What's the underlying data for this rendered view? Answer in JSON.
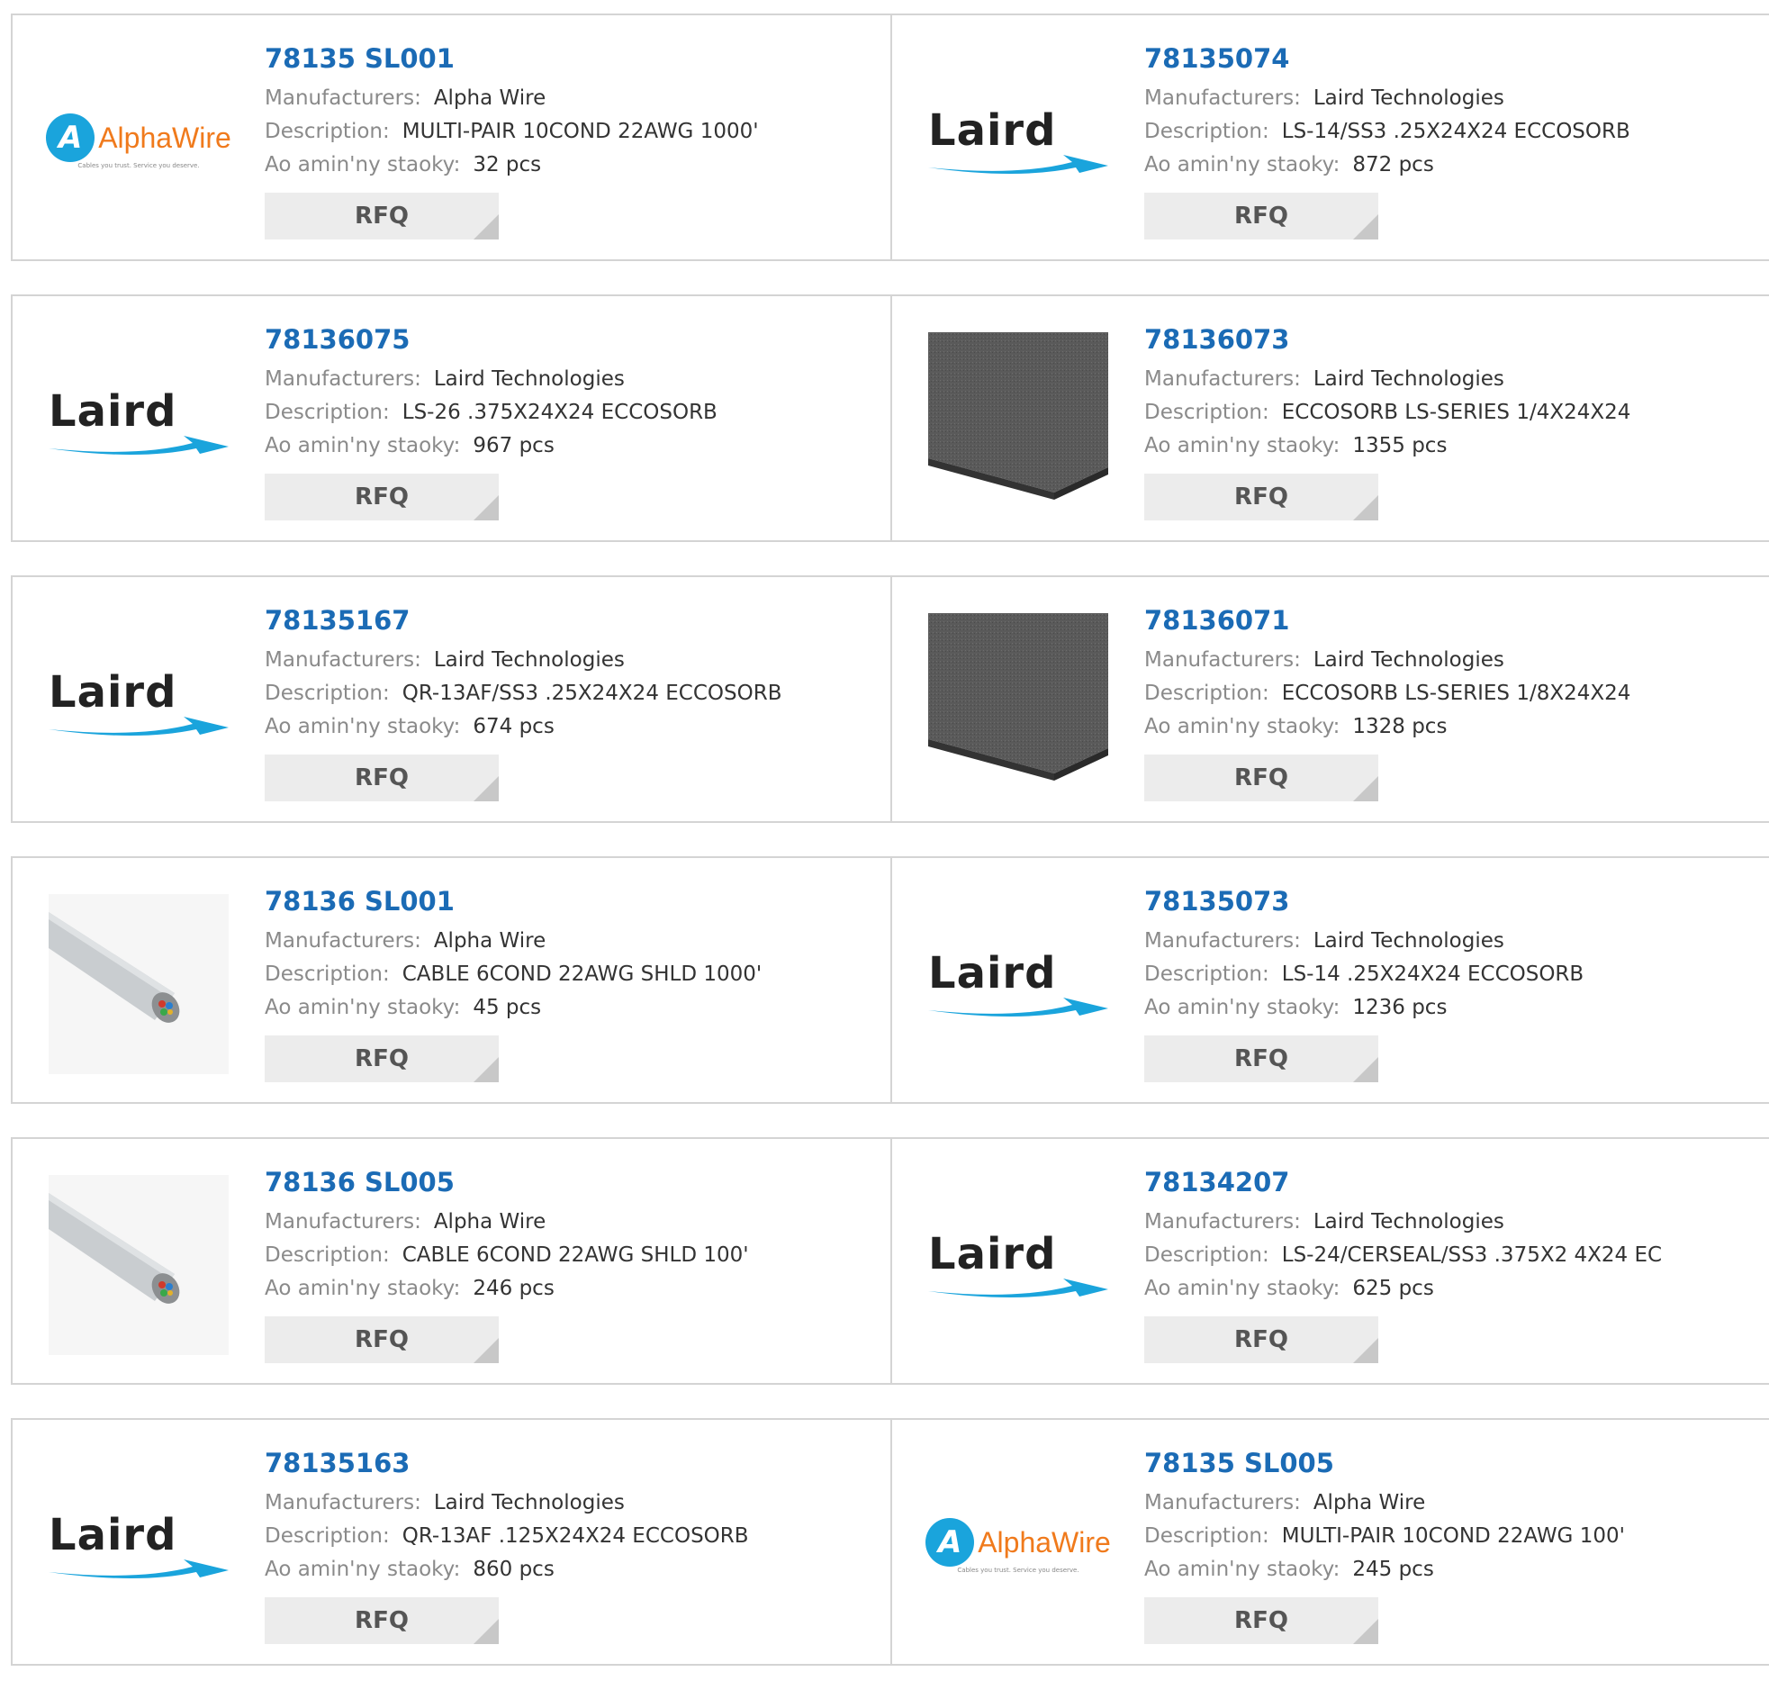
{
  "labels": {
    "manufacturers": "Manufacturers:",
    "description": "Description:",
    "stock": "Ao amin'ny staoky:",
    "rfq": "RFQ"
  },
  "brand_text": {
    "laird": "Laird",
    "alphawire_text": "AlphaWire",
    "alphawire_tagline": "Cables you trust. Service you deserve."
  },
  "products": [
    {
      "part": "78135 SL001",
      "manufacturer": "Alpha Wire",
      "description": "MULTI-PAIR 10COND 22AWG 1000'",
      "stock": "32 pcs",
      "image": "alphawire-logo"
    },
    {
      "part": "78135074",
      "manufacturer": "Laird Technologies",
      "description": "LS-14/SS3 .25X24X24 ECCOSORB",
      "stock": "872 pcs",
      "image": "laird-logo"
    },
    {
      "part": "78136075",
      "manufacturer": "Laird Technologies",
      "description": "LS-26 .375X24X24 ECCOSORB",
      "stock": "967 pcs",
      "image": "laird-logo"
    },
    {
      "part": "78136073",
      "manufacturer": "Laird Technologies",
      "description": "ECCOSORB LS-SERIES 1/4X24X24",
      "stock": "1355 pcs",
      "image": "foam-sheet"
    },
    {
      "part": "78135167",
      "manufacturer": "Laird Technologies",
      "description": "QR-13AF/SS3 .25X24X24 ECCOSORB",
      "stock": "674 pcs",
      "image": "laird-logo"
    },
    {
      "part": "78136071",
      "manufacturer": "Laird Technologies",
      "description": "ECCOSORB LS-SERIES 1/8X24X24",
      "stock": "1328 pcs",
      "image": "foam-sheet"
    },
    {
      "part": "78136 SL001",
      "manufacturer": "Alpha Wire",
      "description": "CABLE 6COND 22AWG SHLD 1000'",
      "stock": "45 pcs",
      "image": "cable"
    },
    {
      "part": "78135073",
      "manufacturer": "Laird Technologies",
      "description": "LS-14 .25X24X24 ECCOSORB",
      "stock": "1236 pcs",
      "image": "laird-logo"
    },
    {
      "part": "78136 SL005",
      "manufacturer": "Alpha Wire",
      "description": "CABLE 6COND 22AWG SHLD 100'",
      "stock": "246 pcs",
      "image": "cable"
    },
    {
      "part": "78134207",
      "manufacturer": "Laird Technologies",
      "description": "LS-24/CERSEAL/SS3 .375X2 4X24 EC",
      "stock": "625 pcs",
      "image": "laird-logo"
    },
    {
      "part": "78135163",
      "manufacturer": "Laird Technologies",
      "description": "QR-13AF .125X24X24 ECCOSORB",
      "stock": "860 pcs",
      "image": "laird-logo"
    },
    {
      "part": "78135 SL005",
      "manufacturer": "Alpha Wire",
      "description": "MULTI-PAIR 10COND 22AWG 100'",
      "stock": "245 pcs",
      "image": "alphawire-logo"
    }
  ],
  "colors": {
    "part_link": "#1b6bb5",
    "label": "#8a8a8a",
    "value": "#333333",
    "rfq_bg": "#ececec",
    "border": "#d4d4d4"
  }
}
